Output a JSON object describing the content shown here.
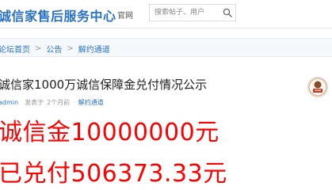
{
  "header": {
    "site_title": "诚信家售后服务中心",
    "nav_home": "官网",
    "search_placeholder": "搜索帖子、用户"
  },
  "breadcrumb": {
    "items": [
      "论坛首页",
      "公告",
      "解约通道"
    ],
    "separator": ">"
  },
  "thread": {
    "title": "诚信家1000万诚信保障金兑付情况公示",
    "author": "admin",
    "posted_prefix": "发表于",
    "posted_time": "2个月前",
    "forum": "解约通道"
  },
  "content": {
    "line1": "诚信金10000000元",
    "line2": "已兑付506373.33元"
  },
  "icons": {
    "search": "search-icon",
    "avatar_badge": "seal-badge-icon"
  },
  "colors": {
    "brand": "#2a72c6",
    "highlight": "#ff0000"
  }
}
